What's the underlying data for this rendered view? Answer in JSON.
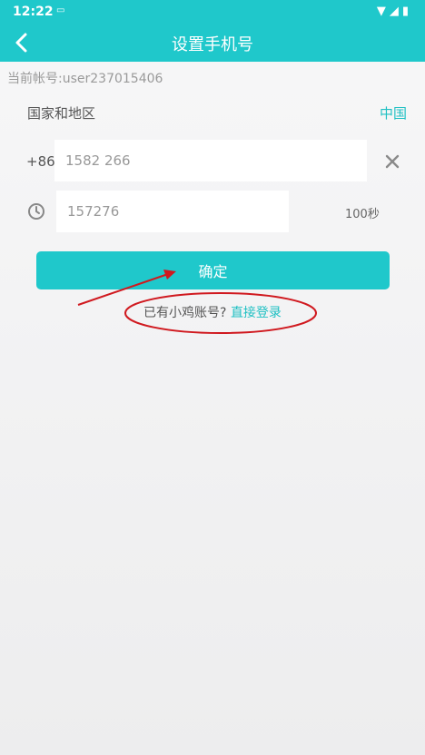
{
  "status_bar": {
    "time": "12:22"
  },
  "header": {
    "title": "设置手机号",
    "back_icon": "chevron-left-icon"
  },
  "account": {
    "text": "当前帐号:user237015406"
  },
  "region": {
    "label": "国家和地区",
    "value": "中国"
  },
  "phone": {
    "prefix": "+86",
    "value": "1582 266"
  },
  "code": {
    "value": "157276",
    "countdown": "100秒"
  },
  "confirm_label": "确定",
  "login": {
    "prompt": "已有小鸡账号? ",
    "link": "直接登录"
  },
  "colors": {
    "accent": "#1fc8cb",
    "annotation": "#d0191f"
  }
}
